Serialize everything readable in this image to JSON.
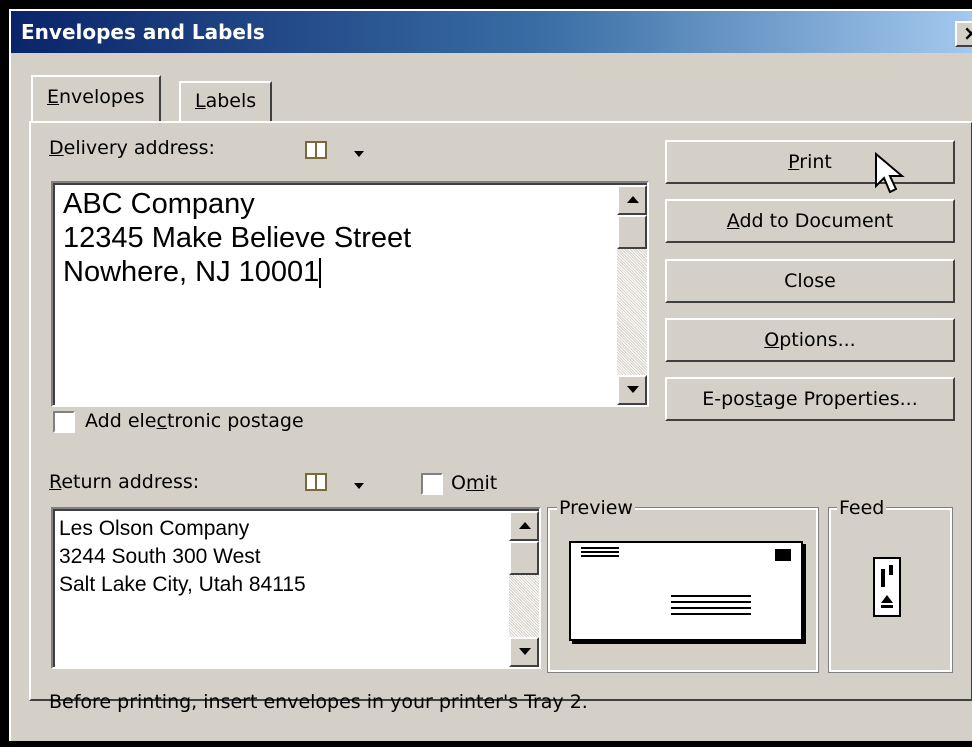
{
  "window": {
    "title": "Envelopes and Labels",
    "close_glyph": "×"
  },
  "tabs": [
    {
      "label": "Envelopes",
      "mnemonic": "E",
      "rest": "nvelopes",
      "active": true
    },
    {
      "label": "Labels",
      "mnemonic": "L",
      "rest": "abels",
      "active": false
    }
  ],
  "delivery": {
    "label_pre": "",
    "label_key": "D",
    "label_post": "elivery address:",
    "lines": [
      "ABC Company",
      "12345 Make Believe Street",
      "Nowhere, NJ 10001"
    ]
  },
  "postage_checkbox": {
    "pre": "Add ele",
    "key": "c",
    "post": "tronic postage",
    "checked": false
  },
  "return": {
    "label_key": "R",
    "label_post": "eturn address:",
    "omit_pre": "O",
    "omit_key": "m",
    "omit_post": "it",
    "omit_checked": false,
    "lines": [
      "Les Olson Company",
      "3244 South 300 West",
      "Salt Lake City, Utah 84115"
    ]
  },
  "buttons": {
    "print": {
      "key": "P",
      "post": "rint"
    },
    "add": {
      "key": "A",
      "post": "dd to Document"
    },
    "close": {
      "label": "Close"
    },
    "options": {
      "key": "O",
      "post": "ptions..."
    },
    "epostage": {
      "pre": "E-pos",
      "key": "t",
      "post": "age Properties..."
    }
  },
  "preview": {
    "title": "Preview"
  },
  "feed": {
    "title": "Feed"
  },
  "status_text": "Before printing, insert envelopes in your printer's Tray 2.",
  "icons": [
    "address-book-icon",
    "dropdown-arrow-icon",
    "scroll-up-icon",
    "scroll-down-icon",
    "mouse-cursor-icon"
  ]
}
